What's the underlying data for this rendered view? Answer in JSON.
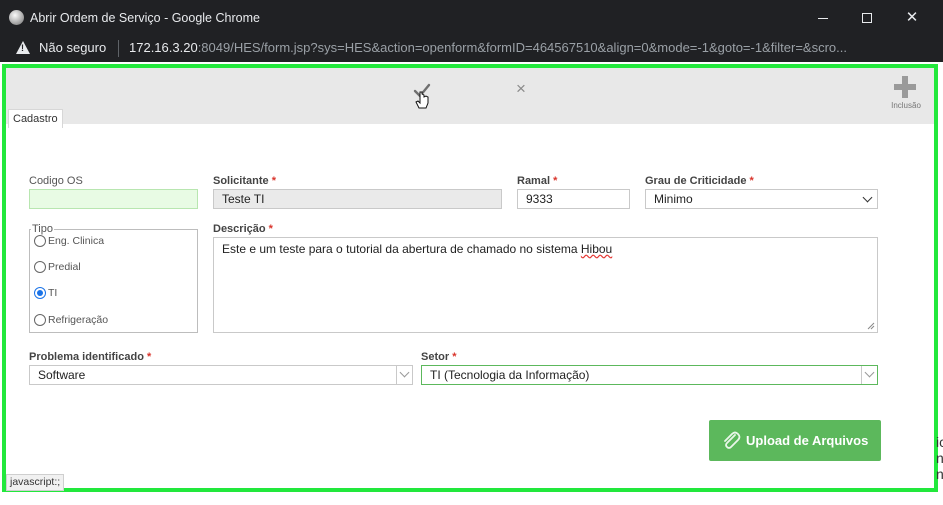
{
  "window": {
    "title": "Abrir Ordem de Serviço - Google Chrome",
    "minimize": "–",
    "maximize": "☐",
    "close": "✕"
  },
  "address_bar": {
    "security": "Não seguro",
    "host": "172.16.3.20",
    "path": ":8049/HES/form.jsp?sys=HES&action=openform&formID=464567510&align=0&mode=-1&goto=-1&filter=&scro..."
  },
  "toolbar": {
    "cancel": "×",
    "add_label": "Inclusão"
  },
  "tab": {
    "label": "Cadastro"
  },
  "form": {
    "codigo_os": {
      "label": "Codigo OS",
      "value": ""
    },
    "solicitante": {
      "label": "Solicitante",
      "required": "*",
      "value": "Teste TI"
    },
    "ramal": {
      "label": "Ramal",
      "required": "*",
      "value": "9333"
    },
    "criticidade": {
      "label": "Grau de Criticidade",
      "required": "*",
      "value": "Minimo"
    },
    "tipo": {
      "label": "Tipo",
      "options": [
        "Eng. Clinica",
        "Predial",
        "TI",
        "Refrigeração"
      ],
      "selected": "TI"
    },
    "descricao": {
      "label": "Descrição",
      "required": "*",
      "value_prefix": "Este e um teste para o tutorial da abertura de chamado no sistema ",
      "value_misspelled": "Hibou"
    },
    "problema": {
      "label": "Problema identificado",
      "required": "*",
      "value": "Software"
    },
    "setor": {
      "label": "Setor",
      "required": "*",
      "value": "TI (Tecnologia da Informação)"
    }
  },
  "upload_button": {
    "label": "Upload de Arquivos"
  },
  "status_bar": {
    "text": "javascript:;"
  },
  "side_text": [
    "ic",
    "n",
    "n"
  ],
  "colors": {
    "highlight_border": "#22e83c",
    "upload_green": "#5cb85c",
    "required": "#d9342b"
  }
}
